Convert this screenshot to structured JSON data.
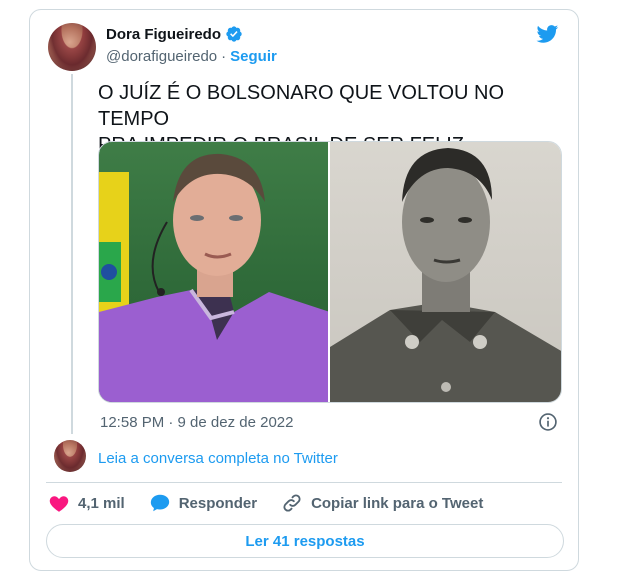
{
  "author": {
    "name": "Dora Figueiredo",
    "handle": "@dorafigueiredo",
    "separator": "·",
    "follow_label": "Seguir"
  },
  "tweet": {
    "line1": "O JUÍZ É O BOLSONARO QUE VOLTOU NO TEMPO",
    "line2": "PRA IMPEDIR O BRASIL DE SER FELIZ",
    "timestamp": "12:58 PM · 9 de dez de 2022"
  },
  "conversation": {
    "link_label": "Leia a conversa completa no Twitter"
  },
  "actions": {
    "like_count": "4,1 mil",
    "reply_label": "Responder",
    "copy_label": "Copiar link para o Tweet"
  },
  "replies_button": "Ler 41 respostas",
  "icons": {
    "verified": "verified-badge-icon",
    "brand": "twitter-bird-icon",
    "info": "info-icon",
    "like": "heart-icon",
    "reply": "speech-bubble-icon",
    "copy": "link-icon"
  },
  "colors": {
    "accent": "#1d9bf0",
    "like": "#f91880",
    "text": "#0f1419",
    "muted": "#536471",
    "border": "#cfd9de"
  }
}
